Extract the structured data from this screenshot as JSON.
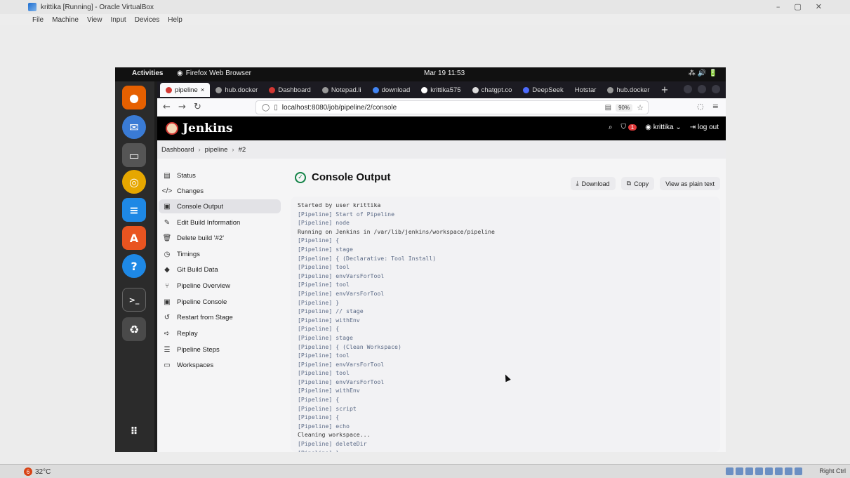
{
  "vbox": {
    "title": "krittika [Running] - Oracle VirtualBox",
    "window_controls": [
      "–",
      "▢",
      "✕"
    ],
    "menu": [
      "File",
      "Machine",
      "View",
      "Input",
      "Devices",
      "Help"
    ],
    "status": {
      "temp": "32°C",
      "temp_badge": "6",
      "host_key": "Right Ctrl"
    }
  },
  "ubuntu": {
    "activities": "Activities",
    "app_name": "Firefox Web Browser",
    "clock": "Mar 19  11:53",
    "tray": "⁂  🔊  🔋"
  },
  "firefox": {
    "tabs": [
      {
        "label": "pipeline",
        "active": true
      },
      {
        "label": "hub.docker",
        "active": false
      },
      {
        "label": "Dashboard",
        "active": false
      },
      {
        "label": "Notepad.li",
        "active": false
      },
      {
        "label": "download",
        "active": false
      },
      {
        "label": "krittika575",
        "active": false
      },
      {
        "label": "chatgpt.co",
        "active": false
      },
      {
        "label": "DeepSeek",
        "active": false
      },
      {
        "label": "Hotstar",
        "active": false
      },
      {
        "label": "hub.docker",
        "active": false
      }
    ],
    "url": "localhost:8080/job/pipeline/2/console",
    "zoom": "90%"
  },
  "jenkins": {
    "brand": "Jenkins",
    "notifications": "1",
    "user": "krittika",
    "logout": "log out",
    "breadcrumb": [
      "Dashboard",
      "pipeline",
      "#2"
    ],
    "sidebar": [
      {
        "label": "Status",
        "icon": "status-icon"
      },
      {
        "label": "Changes",
        "icon": "code-icon"
      },
      {
        "label": "Console Output",
        "icon": "terminal-icon",
        "active": true
      },
      {
        "label": "Edit Build Information",
        "icon": "edit-icon"
      },
      {
        "label": "Delete build '#2'",
        "icon": "trash-icon"
      },
      {
        "label": "Timings",
        "icon": "clock-icon"
      },
      {
        "label": "Git Build Data",
        "icon": "git-icon"
      },
      {
        "label": "Pipeline Overview",
        "icon": "pipeline-icon"
      },
      {
        "label": "Pipeline Console",
        "icon": "terminal-icon"
      },
      {
        "label": "Restart from Stage",
        "icon": "restart-icon"
      },
      {
        "label": "Replay",
        "icon": "replay-icon"
      },
      {
        "label": "Pipeline Steps",
        "icon": "list-icon"
      },
      {
        "label": "Workspaces",
        "icon": "folder-icon"
      }
    ],
    "page_title": "Console Output",
    "actions": {
      "download": "Download",
      "copy": "Copy",
      "plain": "View as plain text"
    },
    "console": [
      "Started by user krittika",
      "[Pipeline] Start of Pipeline",
      "[Pipeline] node",
      "Running on Jenkins in /var/lib/jenkins/workspace/pipeline",
      "[Pipeline] {",
      "[Pipeline] stage",
      "[Pipeline] { (Declarative: Tool Install)",
      "[Pipeline] tool",
      "[Pipeline] envVarsForTool",
      "[Pipeline] tool",
      "[Pipeline] envVarsForTool",
      "[Pipeline] }",
      "[Pipeline] // stage",
      "[Pipeline] withEnv",
      "[Pipeline] {",
      "[Pipeline] stage",
      "[Pipeline] { (Clean Workspace)",
      "[Pipeline] tool",
      "[Pipeline] envVarsForTool",
      "[Pipeline] tool",
      "[Pipeline] envVarsForTool",
      "[Pipeline] withEnv",
      "[Pipeline] {",
      "[Pipeline] script",
      "[Pipeline] {",
      "[Pipeline] echo",
      "Cleaning workspace...",
      "[Pipeline] deleteDir",
      "[Pipeline] }"
    ]
  }
}
